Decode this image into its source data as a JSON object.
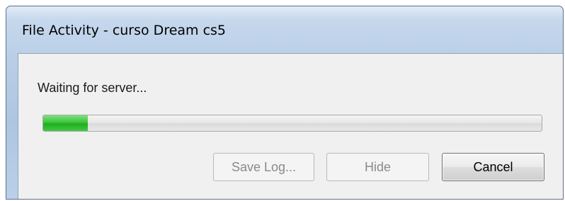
{
  "window": {
    "title": "File Activity - curso Dream cs5"
  },
  "dialog": {
    "status_text": "Waiting for server...",
    "progress_fraction": 0.09
  },
  "buttons": {
    "save_log": "Save Log...",
    "hide": "Hide",
    "cancel": "Cancel"
  },
  "colors": {
    "progress_fill": "#2fbf2f",
    "title_bar": "#b9cde6",
    "client_bg": "#f0f0f0"
  }
}
